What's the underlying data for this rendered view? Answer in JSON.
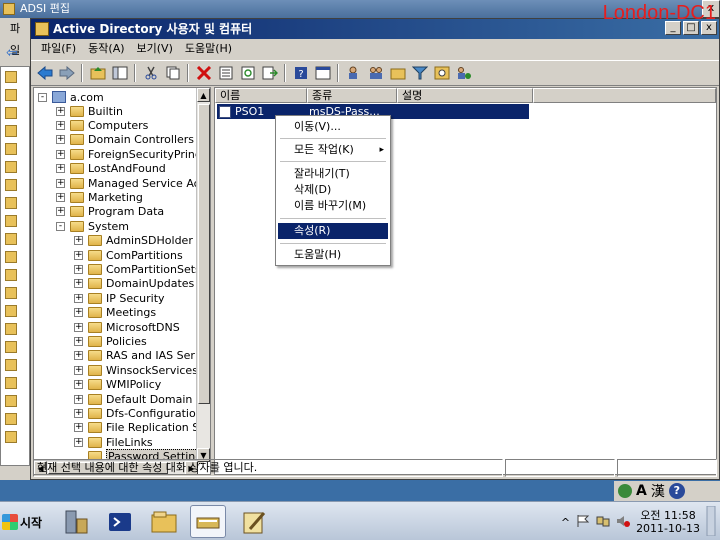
{
  "background_window": {
    "title": "ADSI 편집",
    "menu_fragment": "파일",
    "controls": [
      "x"
    ]
  },
  "server_label": "London-DC1",
  "window": {
    "title": "Active Directory 사용자 및 컴퓨터",
    "controls": [
      "_",
      "□",
      "x"
    ]
  },
  "menubar": [
    "파일(F)",
    "동작(A)",
    "보기(V)",
    "도움말(H)"
  ],
  "toolbar_icons": [
    "back-arrow-icon",
    "forward-arrow-icon",
    "up-folder-icon",
    "show-pane-icon",
    "cut-icon",
    "copy-icon",
    "delete-icon",
    "properties-icon",
    "refresh-icon",
    "export-icon",
    "help-icon",
    "console-icon",
    "add-user-icon",
    "add-group-icon",
    "add-ou-icon",
    "filter-icon",
    "find-icon",
    "move-icon"
  ],
  "tree": {
    "root": "a.com",
    "items": [
      {
        "label": "Builtin",
        "level": 1,
        "expander": "+"
      },
      {
        "label": "Computers",
        "level": 1,
        "expander": "+"
      },
      {
        "label": "Domain Controllers",
        "level": 1,
        "expander": "+"
      },
      {
        "label": "ForeignSecurityPrinc",
        "level": 1,
        "expander": "+"
      },
      {
        "label": "LostAndFound",
        "level": 1,
        "expander": "+"
      },
      {
        "label": "Managed Service Ac",
        "level": 1,
        "expander": "+"
      },
      {
        "label": "Marketing",
        "level": 1,
        "expander": "+"
      },
      {
        "label": "Program Data",
        "level": 1,
        "expander": "+"
      },
      {
        "label": "System",
        "level": 1,
        "expander": "-"
      },
      {
        "label": "AdminSDHolder",
        "level": 2,
        "expander": "+"
      },
      {
        "label": "ComPartitions",
        "level": 2,
        "expander": "+"
      },
      {
        "label": "ComPartitionSets",
        "level": 2,
        "expander": "+"
      },
      {
        "label": "DomainUpdates",
        "level": 2,
        "expander": "+"
      },
      {
        "label": "IP Security",
        "level": 2,
        "expander": "+"
      },
      {
        "label": "Meetings",
        "level": 2,
        "expander": "+"
      },
      {
        "label": "MicrosoftDNS",
        "level": 2,
        "expander": "+"
      },
      {
        "label": "Policies",
        "level": 2,
        "expander": "+"
      },
      {
        "label": "RAS and IAS Ser",
        "level": 2,
        "expander": "+"
      },
      {
        "label": "WinsockServices",
        "level": 2,
        "expander": "+"
      },
      {
        "label": "WMIPolicy",
        "level": 2,
        "expander": "+"
      },
      {
        "label": "Default Domain F",
        "level": 2,
        "expander": "+"
      },
      {
        "label": "Dfs-Configuration",
        "level": 2,
        "expander": "+"
      },
      {
        "label": "File Replication S",
        "level": 2,
        "expander": "+"
      },
      {
        "label": "FileLinks",
        "level": 2,
        "expander": "+"
      },
      {
        "label": "Password Setting",
        "level": 2,
        "expander": "",
        "selected": true
      }
    ]
  },
  "list": {
    "columns": [
      "이름",
      "종류",
      "설명"
    ],
    "rows": [
      {
        "name": "PSO1",
        "type": "msDS-Pass...",
        "description": ""
      }
    ]
  },
  "context_menu": {
    "items": [
      {
        "label": "이동(V)...",
        "active": false
      },
      {
        "label": "모든 작업(K)",
        "active": false,
        "submenu": true
      },
      {
        "label": "잘라내기(T)",
        "active": false
      },
      {
        "label": "삭제(D)",
        "active": false
      },
      {
        "label": "이름 바꾸기(M)",
        "active": false
      },
      {
        "label": "속성(R)",
        "active": true
      },
      {
        "label": "도움말(H)",
        "active": false
      }
    ],
    "submenu_arrow": "▸"
  },
  "status_text": "현재 선택 내용에 대한 속성 대화 상자를 엽니다.",
  "langbar": {
    "ime_a": "A",
    "ime_han": "漢",
    "help": "?"
  },
  "taskbar": {
    "start_label": "시작",
    "apps": [
      "server-manager-icon",
      "powershell-icon",
      "explorer-icon",
      "ad-users-icon",
      "adsi-edit-icon"
    ],
    "tray_chevron": "^",
    "clock_time": "오전 11:58",
    "clock_date": "2011-10-13"
  },
  "colors": {
    "title_active": "#0a246a",
    "selection": "#0a246a",
    "window_face": "#d4d0c8",
    "server_label": "#e61e1e"
  }
}
